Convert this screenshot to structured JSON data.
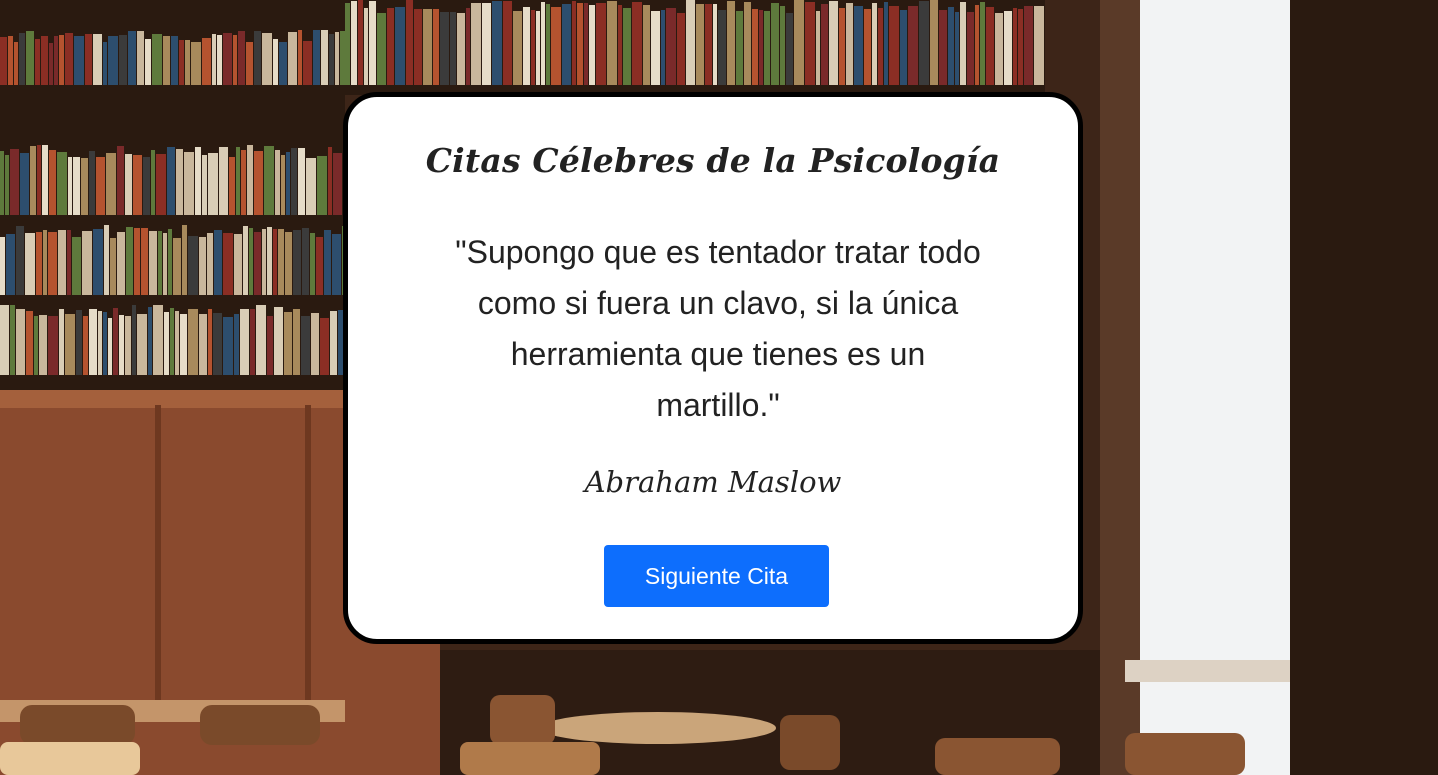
{
  "quote_card": {
    "title": "Citas Célebres de la Psicología",
    "quote": "\"Supongo que es tentador tratar todo como si fuera un clavo, si la única herramienta que tienes es un martillo.\"",
    "author": "Abraham Maslow",
    "next_button_label": "Siguiente Cita"
  },
  "colors": {
    "card_background": "#ffffff",
    "card_border": "#000000",
    "button_background": "#0d6efd",
    "button_text": "#ffffff",
    "text": "#222222"
  }
}
